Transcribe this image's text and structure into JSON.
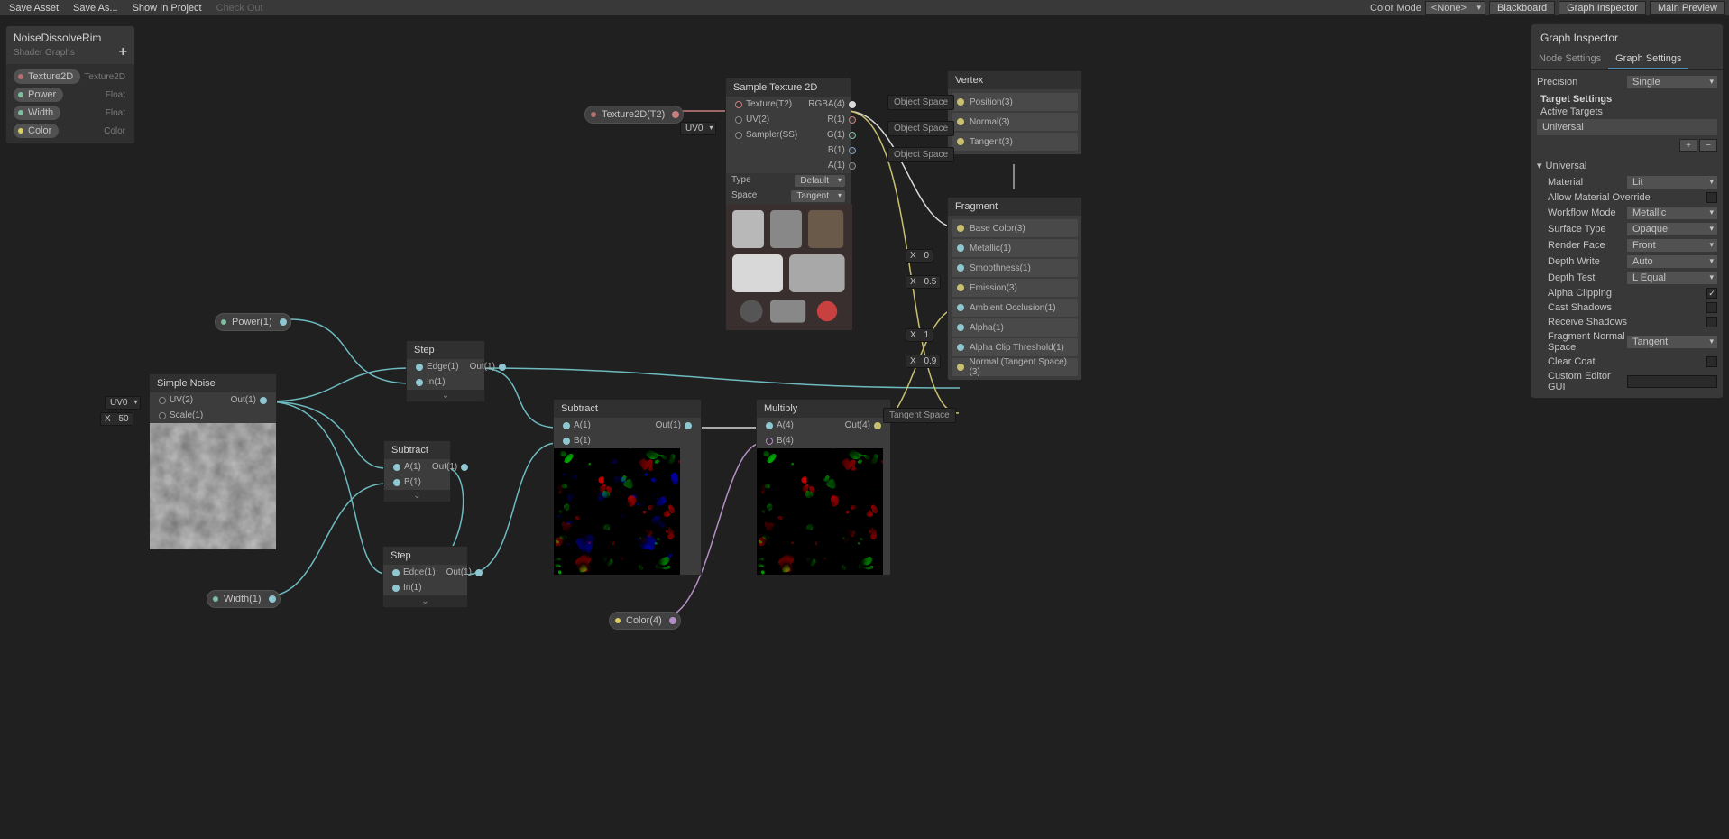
{
  "toolbar": {
    "save_asset": "Save Asset",
    "save_as": "Save As...",
    "show_in_project": "Show In Project",
    "check_out": "Check Out",
    "color_mode_label": "Color Mode",
    "color_mode_value": "<None>",
    "blackboard": "Blackboard",
    "graph_inspector": "Graph Inspector",
    "main_preview": "Main Preview"
  },
  "blackboard": {
    "title": "NoiseDissolveRim",
    "subtitle": "Shader Graphs",
    "add": "+",
    "items": [
      {
        "name": "Texture2D",
        "type": "Texture2D",
        "color": "#b86f6f"
      },
      {
        "name": "Power",
        "type": "Float",
        "color": "#7fbf9f"
      },
      {
        "name": "Width",
        "type": "Float",
        "color": "#7fbf9f"
      },
      {
        "name": "Color",
        "type": "Color",
        "color": "#d8d060"
      }
    ]
  },
  "nodes": {
    "texture2d_prop": {
      "label": "Texture2D(T2)"
    },
    "power_prop": {
      "label": "Power(1)"
    },
    "width_prop": {
      "label": "Width(1)"
    },
    "color_prop": {
      "label": "Color(4)"
    },
    "uv0_dd": "UV0",
    "simple_noise": {
      "title": "Simple Noise",
      "in_uv": "UV(2)",
      "in_scale": "Scale(1)",
      "scale_val": "50",
      "scale_x": "X",
      "out": "Out(1)"
    },
    "step1": {
      "title": "Step",
      "edge": "Edge(1)",
      "in": "In(1)",
      "out": "Out(1)"
    },
    "step2": {
      "title": "Step",
      "edge": "Edge(1)",
      "in": "In(1)",
      "out": "Out(1)"
    },
    "subtract1": {
      "title": "Subtract",
      "a": "A(1)",
      "b": "B(1)",
      "out": "Out(1)"
    },
    "subtract2": {
      "title": "Subtract",
      "a": "A(1)",
      "b": "B(1)",
      "out": "Out(1)"
    },
    "multiply": {
      "title": "Multiply",
      "a": "A(4)",
      "b": "B(4)",
      "out": "Out(4)"
    },
    "sample_tex": {
      "title": "Sample Texture 2D",
      "tex": "Texture(T2)",
      "uv": "UV(2)",
      "sampler": "Sampler(SS)",
      "rgba": "RGBA(4)",
      "r": "R(1)",
      "g": "G(1)",
      "b": "B(1)",
      "a": "A(1)",
      "type_label": "Type",
      "type_val": "Default",
      "space_label": "Space",
      "space_val": "Tangent",
      "uv0": "UV0"
    },
    "vertex": {
      "title": "Vertex",
      "position": "Position(3)",
      "normal": "Normal(3)",
      "tangent": "Tangent(3)",
      "obj_space": "Object Space"
    },
    "fragment": {
      "title": "Fragment",
      "base_color": "Base Color(3)",
      "metallic": "Metallic(1)",
      "metallic_x": "X",
      "metallic_v": "0",
      "smoothness": "Smoothness(1)",
      "smooth_x": "X",
      "smooth_v": "0.5",
      "emission": "Emission(3)",
      "ao": "Ambient Occlusion(1)",
      "ao_x": "X",
      "ao_v": "1",
      "alpha": "Alpha(1)",
      "alpha_x": "X",
      "alpha_v": "0.9",
      "clip": "Alpha Clip Threshold(1)",
      "normal_ts": "Normal (Tangent Space)(3)",
      "tan_space": "Tangent Space"
    }
  },
  "inspector": {
    "title": "Graph Inspector",
    "tab_node": "Node Settings",
    "tab_graph": "Graph Settings",
    "precision_label": "Precision",
    "precision_val": "Single",
    "target_settings": "Target Settings",
    "active_targets": "Active Targets",
    "target_universal": "Universal",
    "add": "+",
    "remove": "−",
    "universal_fold": "Universal",
    "material_label": "Material",
    "material_val": "Lit",
    "allow_override": "Allow Material Override",
    "workflow_label": "Workflow Mode",
    "workflow_val": "Metallic",
    "surface_label": "Surface Type",
    "surface_val": "Opaque",
    "render_face_label": "Render Face",
    "render_face_val": "Front",
    "depth_write_label": "Depth Write",
    "depth_write_val": "Auto",
    "depth_test_label": "Depth Test",
    "depth_test_val": "L Equal",
    "alpha_clip": "Alpha Clipping",
    "alpha_clip_on": "✓",
    "cast_shadows": "Cast Shadows",
    "receive_shadows": "Receive Shadows",
    "frag_normal_label": "Fragment Normal Space",
    "frag_normal_val": "Tangent",
    "clear_coat": "Clear Coat",
    "custom_gui": "Custom Editor GUI"
  }
}
